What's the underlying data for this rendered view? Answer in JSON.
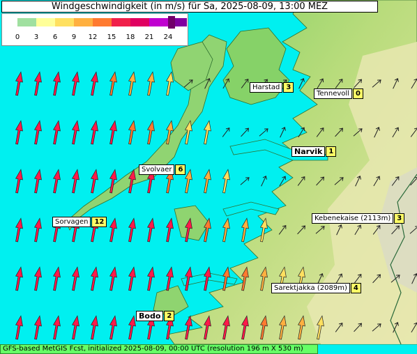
{
  "title": "Windgeschwindigkeit (in m/s) für Sa, 2025-08-09, 13:00 MEZ",
  "legend": {
    "ticks": [
      "0",
      "3",
      "6",
      "9",
      "12",
      "15",
      "18",
      "21",
      "24"
    ],
    "colors": [
      "#a0e0a0",
      "#ffff99",
      "#ffe060",
      "#ffb040",
      "#ff7a30",
      "#f0204a",
      "#e00060",
      "#c000d0",
      "#8000a0"
    ],
    "max_color": "#70006a"
  },
  "colors": {
    "water": "#00f0f0",
    "land_low": "#66cc55",
    "land_mid": "#b8dd77",
    "land_high": "#e8e8a0",
    "peaks": "#d8d8c8"
  },
  "stations": [
    {
      "name": "Harstad",
      "value": "3",
      "bold": false
    },
    {
      "name": "Tennevoll",
      "value": "0",
      "bold": false
    },
    {
      "name": "Narvik",
      "value": "1",
      "bold": true
    },
    {
      "name": "Svolvaer",
      "value": "6",
      "bold": false
    },
    {
      "name": "Sorvagen",
      "value": "12",
      "bold": false
    },
    {
      "name": "Kebenekaise (2113m)",
      "value": "3",
      "bold": false
    },
    {
      "name": "Sarektjakka (2089m)",
      "value": "4",
      "bold": false
    },
    {
      "name": "Bodo",
      "value": "2",
      "bold": true
    }
  ],
  "footer": "GFS-based MetGIS Fcst, initialized 2025-08-09, 00:00 UTC  (resolution 196 m X 530 m)"
}
